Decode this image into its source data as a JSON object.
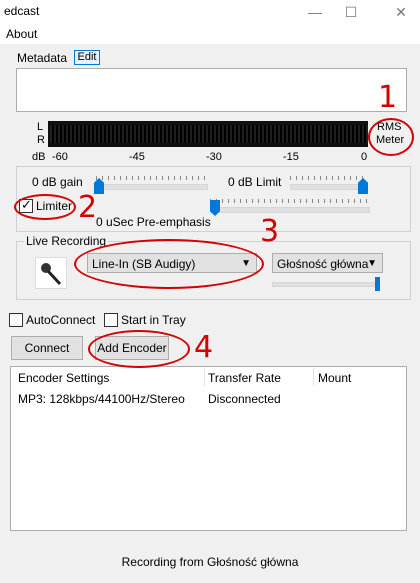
{
  "window": {
    "title": "edcast",
    "minimize": "—",
    "maximize": "☐",
    "close": "✕"
  },
  "menu": {
    "about": "About"
  },
  "tabs": {
    "metadata": "Metadata",
    "edit": "Edit"
  },
  "meter": {
    "channel_left": "L",
    "channel_right": "R",
    "unit": "dB",
    "ticks": [
      "-60",
      "-45",
      "-30",
      "-15",
      "0"
    ],
    "mode_line1": "RMS",
    "mode_line2": "Meter"
  },
  "gain": {
    "gain_label": "0 dB gain",
    "limit_label": "0 dB Limit",
    "limiter_label": "Limiter",
    "limiter_checked": true,
    "preemph_label": "0  uSec Pre-emphasis"
  },
  "live": {
    "group_label": "Live Recording",
    "device": "Line-In (SB Audigy)",
    "channel": "Głośność główna"
  },
  "options": {
    "autoconnect_label": "AutoConnect",
    "tray_label": "Start in Tray"
  },
  "buttons": {
    "connect": "Connect",
    "add_encoder": "Add Encoder"
  },
  "encoders": {
    "columns": [
      "Encoder Settings",
      "Transfer Rate",
      "Mount"
    ],
    "rows": [
      {
        "settings": "MP3: 128kbps/44100Hz/Stereo",
        "rate": "Disconnected",
        "mount": ""
      }
    ]
  },
  "status": "Recording from Głośność główna",
  "annotations": {
    "n1": "1",
    "n2": "2",
    "n3": "3",
    "n4": "4",
    "color": "#d40000"
  }
}
